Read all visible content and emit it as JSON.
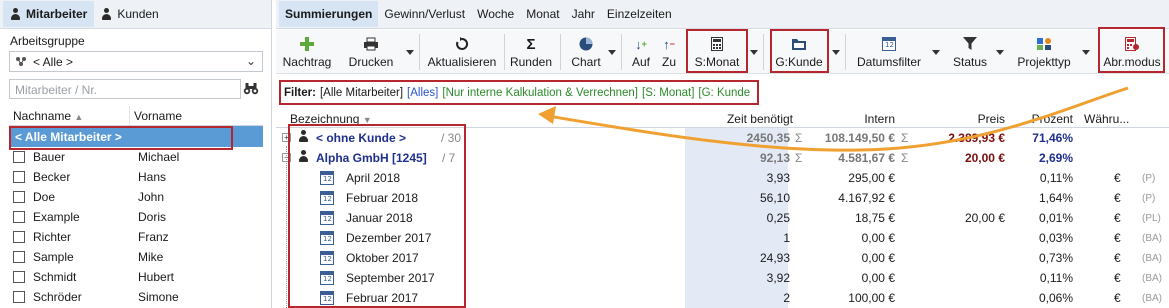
{
  "left_tabs": {
    "mitarbeiter": "Mitarbeiter",
    "kunden": "Kunden"
  },
  "group_label": "Arbeitsgruppe",
  "group_select": "< Alle >",
  "search_placeholder": "Mitarbeiter / Nr.",
  "emp_headers": {
    "last": "Nachname",
    "first": "Vorname"
  },
  "emp_selected": "< Alle Mitarbeiter >",
  "employees": [
    {
      "last": "Bauer",
      "first": "Michael"
    },
    {
      "last": "Becker",
      "first": "Hans"
    },
    {
      "last": "Doe",
      "first": "John"
    },
    {
      "last": "Example",
      "first": "Doris"
    },
    {
      "last": "Richter",
      "first": "Franz"
    },
    {
      "last": "Sample",
      "first": "Mike"
    },
    {
      "last": "Schmidt",
      "first": "Hubert"
    },
    {
      "last": "Schröder",
      "first": "Simone"
    }
  ],
  "right_tabs": [
    "Summierungen",
    "Gewinn/Verlust",
    "Woche",
    "Monat",
    "Jahr",
    "Einzelzeiten"
  ],
  "toolbar": {
    "nachtrag": "Nachtrag",
    "drucken": "Drucken",
    "aktualisieren": "Aktualisieren",
    "runden": "Runden",
    "chart": "Chart",
    "auf": "Auf",
    "zu": "Zu",
    "smonat": "S:Monat",
    "gkunde": "G:Kunde",
    "datumsfilter": "Datumsfilter",
    "status": "Status",
    "projekttyp": "Projekttyp",
    "abrmodus": "Abr.modus"
  },
  "filter": {
    "label": "Filter:",
    "f1": "[Alle Mitarbeiter]",
    "f2": "[Alles]",
    "f3": "[Nur interne Kalkulation & Verrechnen]",
    "f4": "[S: Monat]",
    "f5": "[G: Kunde"
  },
  "grid_headers": {
    "bezeichnung": "Bezeichnung",
    "zeit": "Zeit benötigt",
    "intern": "Intern",
    "preis": "Preis",
    "prozent": "Prozent",
    "waehrung": "Währu..."
  },
  "group_rows": [
    {
      "name": "< ohne Kunde >",
      "count": "/ 30",
      "zeit": "2450,35",
      "sigma1": "Σ",
      "intern": "108.149,50 €",
      "sigma2": "Σ",
      "preis": "2.389,93 €",
      "prozent": "71,46%"
    },
    {
      "name": "Alpha GmbH [1245]",
      "count": "/ 7",
      "zeit": "92,13",
      "sigma1": "Σ",
      "intern": "4.581,67 €",
      "sigma2": "Σ",
      "preis": "20,00 €",
      "prozent": "2,69%"
    }
  ],
  "month_rows": [
    {
      "name": "April 2018",
      "zeit": "3,93",
      "intern": "295,00 €",
      "preis": "",
      "prozent": "0,11%",
      "cur": "€",
      "code": "(P)"
    },
    {
      "name": "Februar 2018",
      "zeit": "56,10",
      "intern": "4.167,92 €",
      "preis": "",
      "prozent": "1,64%",
      "cur": "€",
      "code": "(P)"
    },
    {
      "name": "Januar 2018",
      "zeit": "0,25",
      "intern": "18,75 €",
      "preis": "20,00 €",
      "prozent": "0,01%",
      "cur": "€",
      "code": "(PL)"
    },
    {
      "name": "Dezember 2017",
      "zeit": "1",
      "intern": "0,00 €",
      "preis": "",
      "prozent": "0,03%",
      "cur": "€",
      "code": "(BA)"
    },
    {
      "name": "Oktober 2017",
      "zeit": "24,93",
      "intern": "0,00 €",
      "preis": "",
      "prozent": "0,73%",
      "cur": "€",
      "code": "(BA)"
    },
    {
      "name": "September 2017",
      "zeit": "3,92",
      "intern": "0,00 €",
      "preis": "",
      "prozent": "0,11%",
      "cur": "€",
      "code": "(BA)"
    },
    {
      "name": "Februar 2017",
      "zeit": "2",
      "intern": "100,00 €",
      "preis": "",
      "prozent": "0,06%",
      "cur": "€",
      "code": "(BA)"
    }
  ],
  "colors": {
    "accent": "#5b9bd5",
    "highlight_box": "#b5262f",
    "arrow": "#f0a030",
    "link": "#1f2f8c",
    "price": "#7a0d0d"
  }
}
